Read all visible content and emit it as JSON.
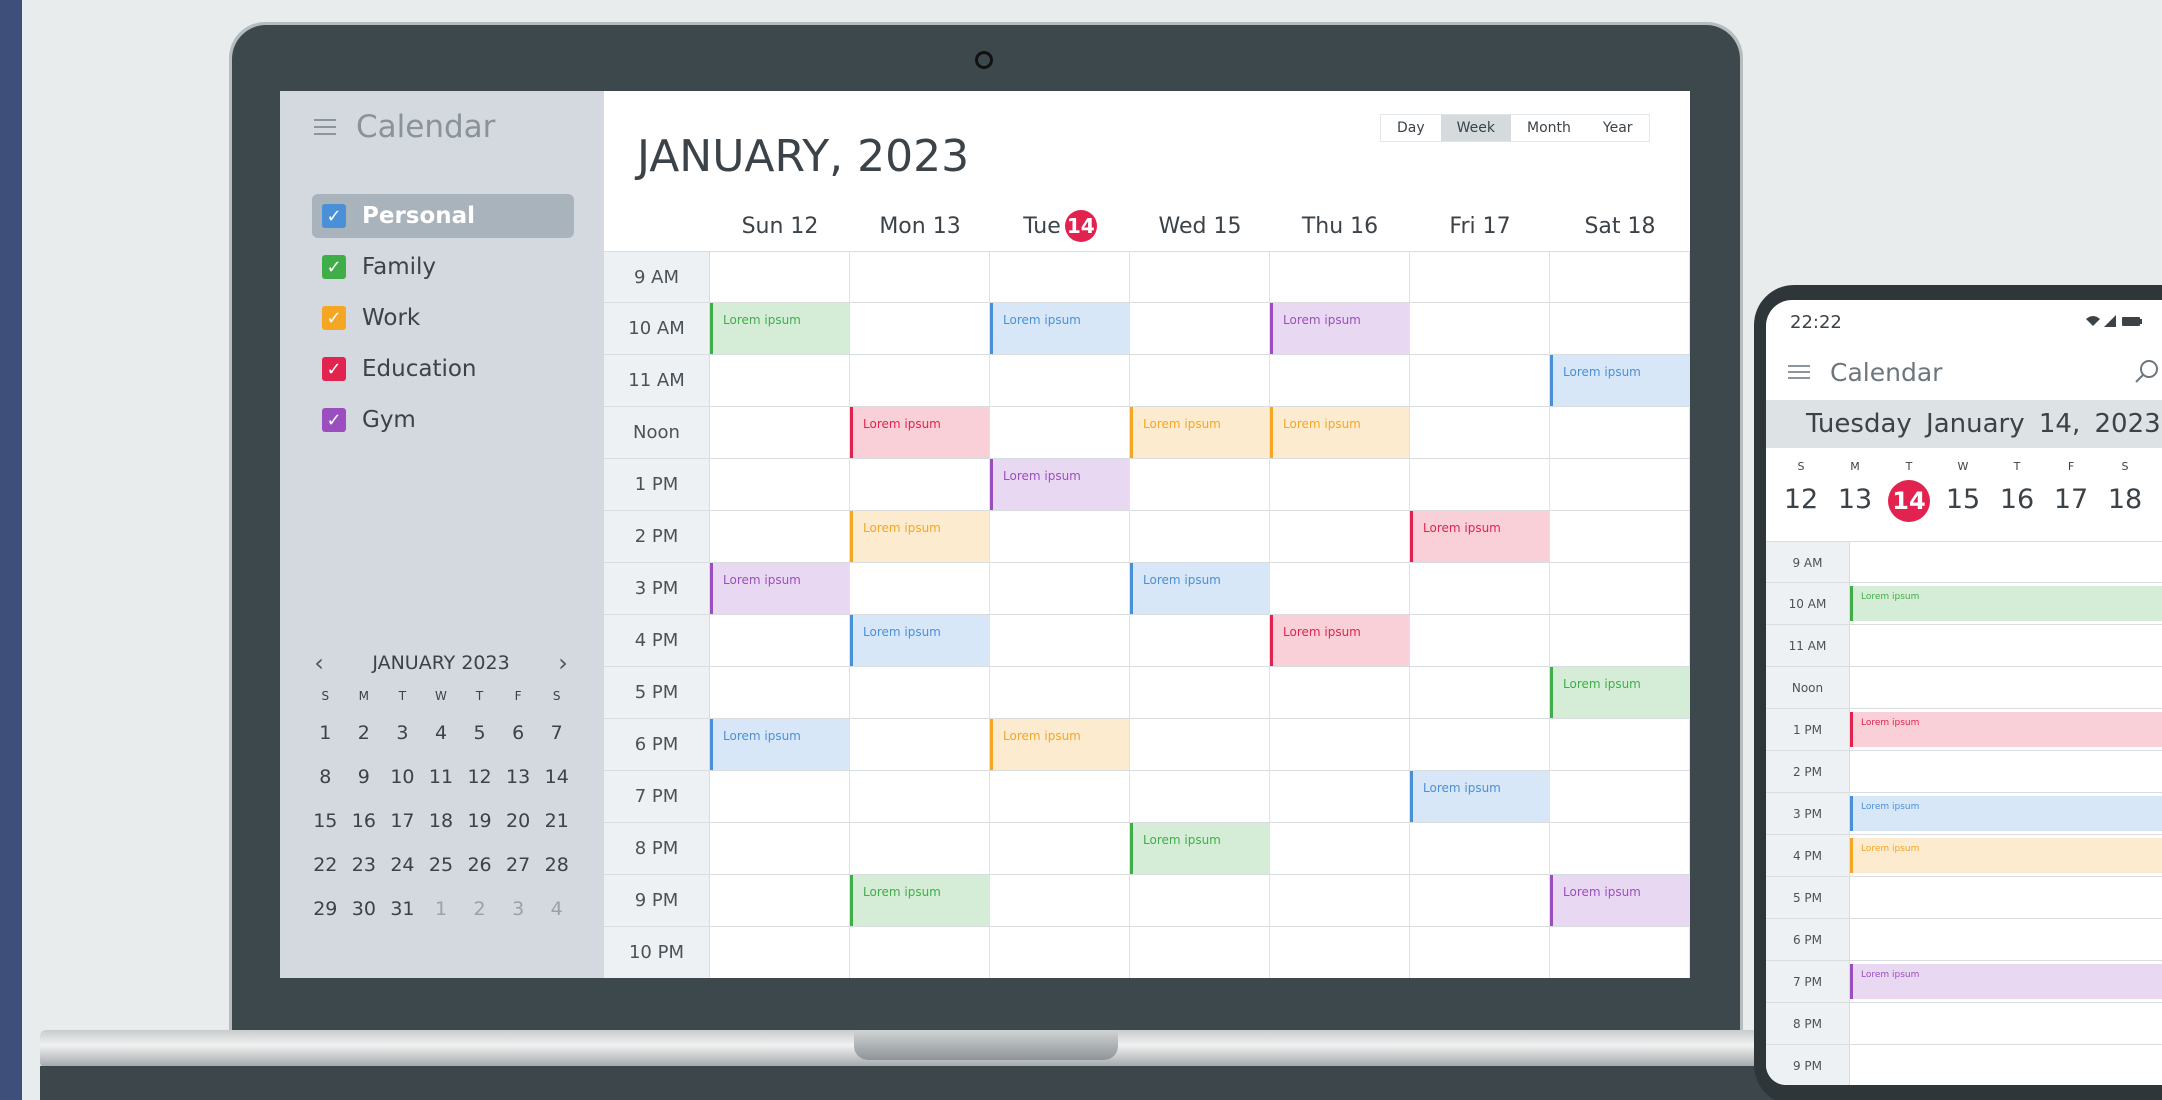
{
  "colors": {
    "personal": "#4a90d9",
    "family": "#3fae49",
    "work": "#f5a623",
    "education": "#e2234f",
    "gym": "#9b4fbf"
  },
  "laptop": {
    "sidebar": {
      "title": "Calendar",
      "calendars": [
        {
          "label": "Personal",
          "color": "#4a90d9",
          "checked": true,
          "active": true
        },
        {
          "label": "Family",
          "color": "#3fae49",
          "checked": true,
          "active": false
        },
        {
          "label": "Work",
          "color": "#f5a623",
          "checked": true,
          "active": false
        },
        {
          "label": "Education",
          "color": "#e2234f",
          "checked": true,
          "active": false
        },
        {
          "label": "Gym",
          "color": "#9b4fbf",
          "checked": true,
          "active": false
        }
      ],
      "mini_calendar": {
        "month_label": "JANUARY 2023",
        "prev_icon": "chevron-left-icon",
        "next_icon": "chevron-right-icon",
        "weekdays": [
          "S",
          "M",
          "T",
          "W",
          "T",
          "F",
          "S"
        ],
        "weeks": [
          [
            "1",
            "2",
            "3",
            "4",
            "5",
            "6",
            "7"
          ],
          [
            "8",
            "9",
            "10",
            "11",
            "12",
            "13",
            "14"
          ],
          [
            "15",
            "16",
            "17",
            "18",
            "19",
            "20",
            "21"
          ],
          [
            "22",
            "23",
            "24",
            "25",
            "26",
            "27",
            "28"
          ],
          [
            "29",
            "30",
            "31",
            "1",
            "2",
            "3",
            "4"
          ]
        ],
        "muted_last_row_from": 3
      }
    },
    "main": {
      "title": "JANUARY, 2023",
      "views": [
        "Day",
        "Week",
        "Month",
        "Year"
      ],
      "active_view": "Week",
      "days": [
        {
          "label": "Sun 12"
        },
        {
          "label": "Mon 13"
        },
        {
          "label": "Tue",
          "today_num": "14"
        },
        {
          "label": "Wed 15"
        },
        {
          "label": "Thu 16"
        },
        {
          "label": "Fri 17"
        },
        {
          "label": "Sat 18"
        }
      ],
      "times": [
        "9 AM",
        "10 AM",
        "11 AM",
        "Noon",
        "1 PM",
        "2 PM",
        "3 PM",
        "4 PM",
        "5 PM",
        "6 PM",
        "7 PM",
        "8 PM",
        "9 PM",
        "10 PM"
      ],
      "events": [
        {
          "day": 0,
          "time": 1,
          "cal": "family",
          "text": "Lorem ipsum"
        },
        {
          "day": 2,
          "time": 1,
          "cal": "personal",
          "text": "Lorem ipsum"
        },
        {
          "day": 4,
          "time": 1,
          "cal": "gym",
          "text": "Lorem ipsum"
        },
        {
          "day": 6,
          "time": 2,
          "cal": "personal",
          "text": "Lorem ipsum"
        },
        {
          "day": 1,
          "time": 3,
          "cal": "education",
          "text": "Lorem ipsum"
        },
        {
          "day": 3,
          "time": 3,
          "cal": "work",
          "text": "Lorem ipsum"
        },
        {
          "day": 4,
          "time": 3,
          "cal": "work",
          "text": "Lorem ipsum"
        },
        {
          "day": 2,
          "time": 4,
          "cal": "gym",
          "text": "Lorem ipsum"
        },
        {
          "day": 1,
          "time": 5,
          "cal": "work",
          "text": "Lorem ipsum"
        },
        {
          "day": 5,
          "time": 5,
          "cal": "education",
          "text": "Lorem ipsum"
        },
        {
          "day": 0,
          "time": 6,
          "cal": "gym",
          "text": "Lorem ipsum"
        },
        {
          "day": 3,
          "time": 6,
          "cal": "personal",
          "text": "Lorem ipsum"
        },
        {
          "day": 1,
          "time": 7,
          "cal": "personal",
          "text": "Lorem ipsum"
        },
        {
          "day": 4,
          "time": 7,
          "cal": "education",
          "text": "Lorem ipsum"
        },
        {
          "day": 6,
          "time": 8,
          "cal": "family",
          "text": "Lorem ipsum"
        },
        {
          "day": 0,
          "time": 9,
          "cal": "personal",
          "text": "Lorem ipsum"
        },
        {
          "day": 2,
          "time": 9,
          "cal": "work",
          "text": "Lorem ipsum"
        },
        {
          "day": 5,
          "time": 10,
          "cal": "personal",
          "text": "Lorem ipsum"
        },
        {
          "day": 3,
          "time": 11,
          "cal": "family",
          "text": "Lorem ipsum"
        },
        {
          "day": 1,
          "time": 12,
          "cal": "family",
          "text": "Lorem ipsum"
        },
        {
          "day": 6,
          "time": 12,
          "cal": "gym",
          "text": "Lorem ipsum"
        }
      ]
    }
  },
  "phone": {
    "status_time": "22:22",
    "status_icons": "wifi-signal-battery-icons",
    "title": "Calendar",
    "search_icon": "search-icon",
    "date_bar": "Tuesday  January 14, 2023",
    "week": [
      {
        "dow": "S",
        "num": "12"
      },
      {
        "dow": "M",
        "num": "13"
      },
      {
        "dow": "T",
        "num": "14",
        "today": true
      },
      {
        "dow": "W",
        "num": "15"
      },
      {
        "dow": "T",
        "num": "16"
      },
      {
        "dow": "F",
        "num": "17"
      },
      {
        "dow": "S",
        "num": "18"
      }
    ],
    "times": [
      "9 AM",
      "10 AM",
      "11 AM",
      "Noon",
      "1 PM",
      "2 PM",
      "3 PM",
      "4 PM",
      "5 PM",
      "6 PM",
      "7 PM",
      "8 PM",
      "9 PM"
    ],
    "events": [
      {
        "time": 1,
        "cal": "family",
        "text": "Lorem ipsum"
      },
      {
        "time": 4,
        "cal": "education",
        "text": "Lorem ipsum"
      },
      {
        "time": 6,
        "cal": "personal",
        "text": "Lorem ipsum"
      },
      {
        "time": 7,
        "cal": "work",
        "text": "Lorem ipsum"
      },
      {
        "time": 10,
        "cal": "gym",
        "text": "Lorem ipsum"
      }
    ]
  }
}
